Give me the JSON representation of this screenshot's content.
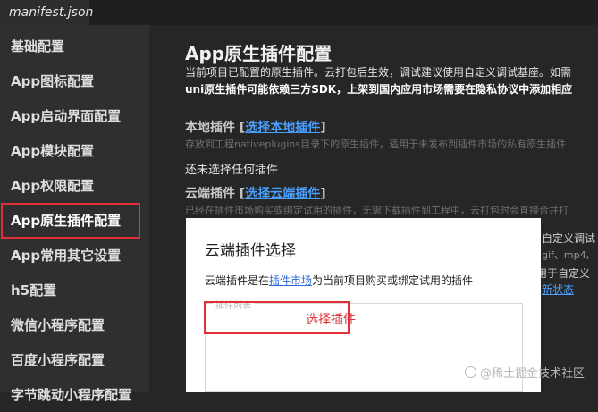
{
  "tab": {
    "label": "manifest.json"
  },
  "sidebar": {
    "items": [
      {
        "label": "基础配置"
      },
      {
        "label": "App图标配置"
      },
      {
        "label": "App启动界面配置"
      },
      {
        "label": "App模块配置"
      },
      {
        "label": "App权限配置"
      },
      {
        "label": "App原生插件配置"
      },
      {
        "label": "App常用其它设置"
      },
      {
        "label": "h5配置"
      },
      {
        "label": "微信小程序配置"
      },
      {
        "label": "百度小程序配置"
      },
      {
        "label": "字节跳动小程序配置"
      }
    ],
    "active_index": 5
  },
  "main": {
    "title": "App原生插件配置",
    "desc1": "当前项目已配置的原生插件。云打包后生效，调试建议使用自定义调试基座。如需",
    "desc2": "uni原生插件可能依赖三方SDK，上架到国内应用市场需要在隐私协议中添加相应",
    "local": {
      "label": "本地插件",
      "link": "选择本地插件",
      "hint": "存放到工程nativeplugins目录下的原生插件，适用于未发布到插件市场的私有原生插件"
    },
    "empty_text": "还未选择任何插件",
    "cloud": {
      "label": "云端插件",
      "link": "选择云端插件",
      "hint": "已经在插件市场购买或绑定试用的插件，无需下载插件到工程中，云打包时会直接合并打"
    },
    "right_fragments": {
      "r1": "自定义调试",
      "r2": "gif、mp4,",
      "r3": "用于自定义",
      "r4": "新状态"
    }
  },
  "dialog": {
    "title": "云端插件选择",
    "desc_prefix": "云端插件是在",
    "desc_link": "插件市场",
    "desc_suffix": "为当前项目购买或绑定试用的插件",
    "list_legend": "插件列表",
    "annotation": "选择插件"
  },
  "watermark": "@稀土掘金技术社区",
  "colors": {
    "accent": "#4aa0ff",
    "highlight": "#e0303a"
  }
}
